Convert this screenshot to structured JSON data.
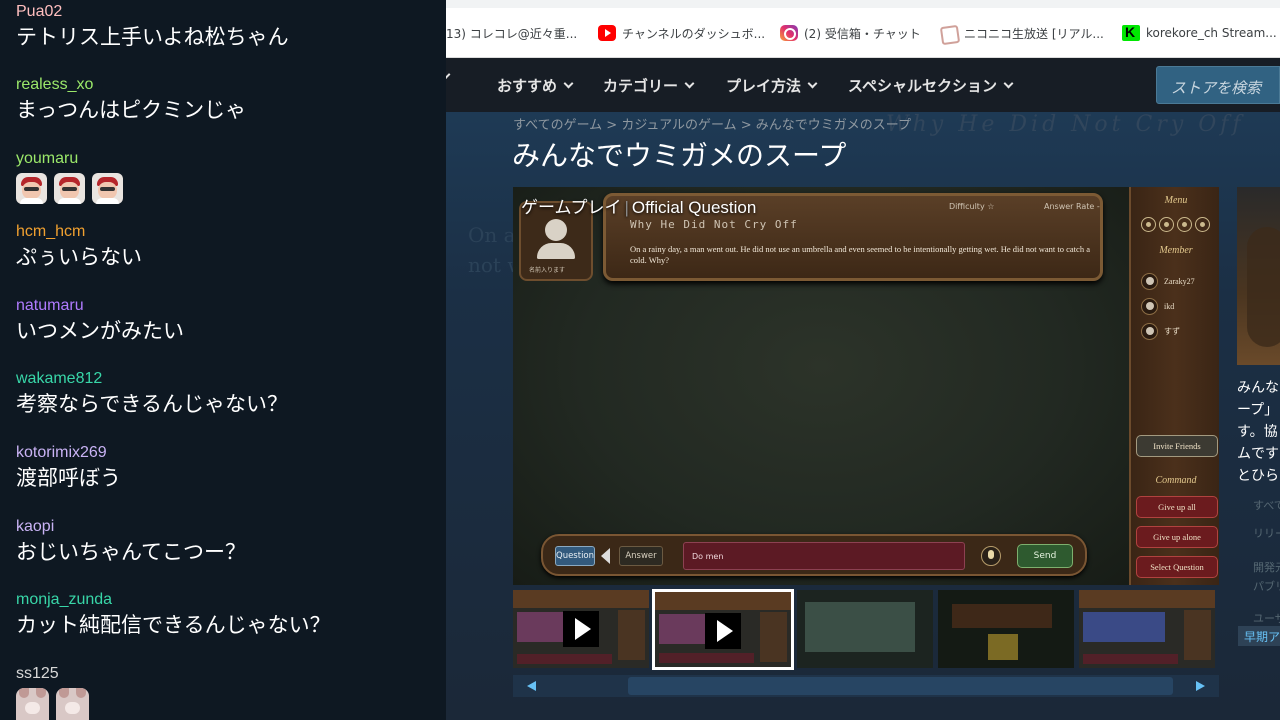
{
  "chat": {
    "messages": [
      {
        "user": "Pua02",
        "color": "#ffbfbf",
        "text": "テトリス上手いよね松ちゃん"
      },
      {
        "user": "realess_xo",
        "color": "#9be86a",
        "text": "まっつんはピクミンじゃ"
      },
      {
        "user": "youmaru",
        "color": "#9be86a",
        "text": ""
      },
      {
        "user": "hcm_hcm",
        "color": "#f0a030",
        "text": "ぷぅいらない"
      },
      {
        "user": "natumaru",
        "color": "#b07bff",
        "text": "いつメンがみたい"
      },
      {
        "user": "wakame812",
        "color": "#38d6a8",
        "text": "考察ならできるんじゃない？"
      },
      {
        "user": "kotorimix269",
        "color": "#c9b3f5",
        "text": "渡部呼ぼう"
      },
      {
        "user": "kaopi",
        "color": "#c9b3f5",
        "text": "おじいちゃんてこつー？"
      },
      {
        "user": "monja_zunda",
        "color": "#38d6a8",
        "text": "カット純配信できるんじゃない？"
      },
      {
        "user": "ss125",
        "color": "#d8d8d8",
        "text": ""
      }
    ]
  },
  "bookmarks": [
    {
      "icon": "none",
      "label": "13) コレコレ@近々重..."
    },
    {
      "icon": "youtube-icon",
      "label": "チャンネルのダッシュボ..."
    },
    {
      "icon": "instagram-icon",
      "label": "(2) 受信箱・チャット"
    },
    {
      "icon": "niconico-icon",
      "label": "ニコニコ生放送 [リアル..."
    },
    {
      "icon": "kick-icon",
      "label": "korekore_ch Stream..."
    }
  ],
  "steam": {
    "nav": [
      "おすすめ",
      "カテゴリー",
      "プレイ方法",
      "スペシャルセクション"
    ],
    "search_placeholder": "ストアを検索",
    "breadcrumb": "すべてのゲーム > カジュアルのゲーム > みんなでウミガメのスープ",
    "title": "みんなでウミガメのスープ",
    "bg_deco_title": "Why He Did Not Cry Off",
    "bg_deco_text1": "On a",
    "bg_deco_text2": "not w",
    "game": {
      "overlay_left": "ゲームプレイ",
      "overlay_right": "Official Question",
      "question_title": "Why He Did Not Cry Off",
      "question_text": "On a rainy day, a man went out. He did not use an umbrella and even seemed to be intentionally getting wet. He did not want to catch a cold. Why?",
      "difficulty_label": "Difficulty",
      "answer_rate_label": "Answer Rate -",
      "avatar_caption": "名前入ります",
      "menu_label": "Menu",
      "member_label": "Member",
      "members": [
        "Zaraky27",
        "ikd",
        "すず"
      ],
      "invite_label": "Invite Friends",
      "command_label": "Command",
      "commands": [
        "Give up all",
        "Give up alone",
        "Select Question"
      ],
      "question_tab": "Question",
      "answer_tab": "Answer",
      "input_value": "Do men",
      "send_label": "Send"
    },
    "right_info": [
      "みんな",
      "ープ」",
      "す。協",
      "ムです",
      "とひら"
    ],
    "right_small": [
      "すべての",
      "リリース",
      "開発元:",
      "パブリッ",
      "ユーザ"
    ],
    "early_tag": "早期ア"
  }
}
